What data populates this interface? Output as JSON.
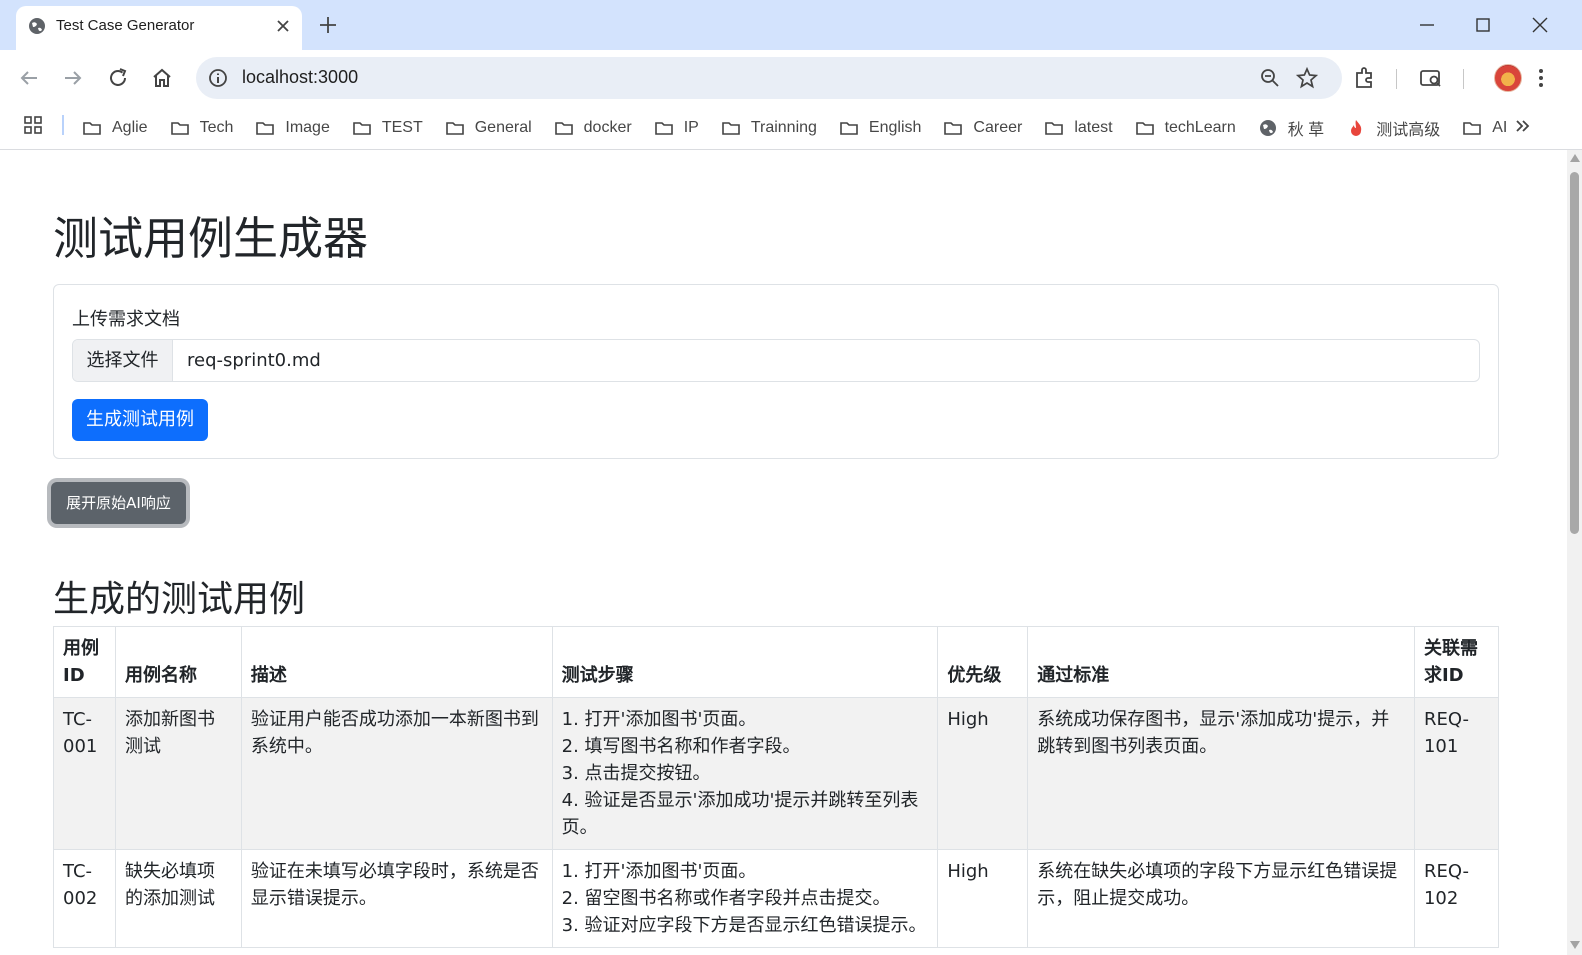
{
  "browser": {
    "tab_title": "Test Case Generator",
    "url": "localhost:3000",
    "bookmarks": [
      {
        "label": "Aglie",
        "icon": "folder-icon"
      },
      {
        "label": "Tech",
        "icon": "folder-icon"
      },
      {
        "label": "Image",
        "icon": "folder-icon"
      },
      {
        "label": "TEST",
        "icon": "folder-icon"
      },
      {
        "label": "General",
        "icon": "folder-icon"
      },
      {
        "label": "docker",
        "icon": "folder-icon"
      },
      {
        "label": "IP",
        "icon": "folder-icon"
      },
      {
        "label": "Trainning",
        "icon": "folder-icon"
      },
      {
        "label": "English",
        "icon": "folder-icon"
      },
      {
        "label": "Career",
        "icon": "folder-icon"
      },
      {
        "label": "latest",
        "icon": "folder-icon"
      },
      {
        "label": "techLearn",
        "icon": "folder-icon"
      },
      {
        "label": "秋 草",
        "icon": "globe-icon"
      },
      {
        "label": "测试高级",
        "icon": "flame-icon"
      },
      {
        "label": "AI",
        "icon": "folder-icon"
      }
    ]
  },
  "page": {
    "title": "测试用例生成器",
    "upload": {
      "label": "上传需求文档",
      "choose_button": "选择文件",
      "file_name": "req-sprint0.md",
      "generate_button": "生成测试用例"
    },
    "raw_toggle_button": "展开原始AI响应",
    "results_title": "生成的测试用例"
  },
  "table": {
    "headers": [
      "用例ID",
      "用例名称",
      "描述",
      "测试步骤",
      "优先级",
      "通过标准",
      "关联需求ID"
    ],
    "rows": [
      {
        "id": "TC-001",
        "name": "添加新图书测试",
        "description": "验证用户能否成功添加一本新图书到系统中。",
        "steps": [
          "1. 打开'添加图书'页面。",
          "2. 填写图书名称和作者字段。",
          "3. 点击提交按钮。",
          "4. 验证是否显示'添加成功'提示并跳转至列表页。"
        ],
        "priority": "High",
        "criteria": "系统成功保存图书，显示'添加成功'提示，并跳转到图书列表页面。",
        "req_id": "REQ-101"
      },
      {
        "id": "TC-002",
        "name": "缺失必填项的添加测试",
        "description": "验证在未填写必填字段时，系统是否显示错误提示。",
        "steps": [
          "1. 打开'添加图书'页面。",
          "2. 留空图书名称或作者字段并点击提交。",
          "3. 验证对应字段下方是否显示红色错误提示。"
        ],
        "priority": "High",
        "criteria": "系统在缺失必填项的字段下方显示红色错误提示，阻止提交成功。",
        "req_id": "REQ-102"
      }
    ]
  },
  "colors": {
    "primary": "#0d6efd",
    "secondary": "#5c636a",
    "browser_frame": "#d3e3fd"
  }
}
